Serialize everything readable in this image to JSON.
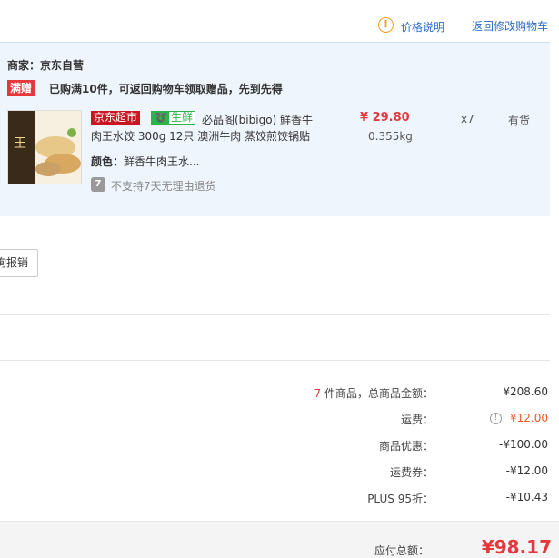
{
  "header": {
    "price_note": "价格说明",
    "back_to_cart": "返回修改购物车",
    "info_icon": "!"
  },
  "order": {
    "merchant": "商家：京东自营",
    "gift_badge": "满赠",
    "gift_text": "已购满10件，可返回购物车领取赠品，先到先得",
    "product": {
      "tag_jd": "京东超市",
      "tag_fresh": "生鲜",
      "title_line1": "必品阁(bibigo) 鲜香牛",
      "title_line2": "肉王水饺 300g 12只 澳洲牛肉 蒸饺煎饺锅贴",
      "price": "¥ 29.80",
      "weight": "0.355kg",
      "quantity": "x7",
      "stock": "有货",
      "color_label": "颜色：",
      "color_value": "鲜香牛肉王水...",
      "return_icon": "7",
      "return_text": "不支持7天无理由退货"
    }
  },
  "report_button": "询报销",
  "summary": {
    "count_num": "7",
    "count_label": " 件商品，总商品金额：",
    "count_val": "¥208.60",
    "freight_label": "运费：",
    "freight_info": "!",
    "freight_val": "¥12.00",
    "discount_label": "商品优惠：",
    "discount_val": "-¥100.00",
    "coupon_label": "运费券：",
    "coupon_val": "-¥12.00",
    "plus_label": "PLUS 95折：",
    "plus_val": "-¥10.43"
  },
  "total": {
    "label": "应付总额：",
    "value": "¥98.17"
  },
  "colors": {
    "accent_red": "#e4393c",
    "link_blue": "#2a6ac8",
    "fresh_green": "#2cb34a",
    "panel_bg": "#eef5fd"
  }
}
